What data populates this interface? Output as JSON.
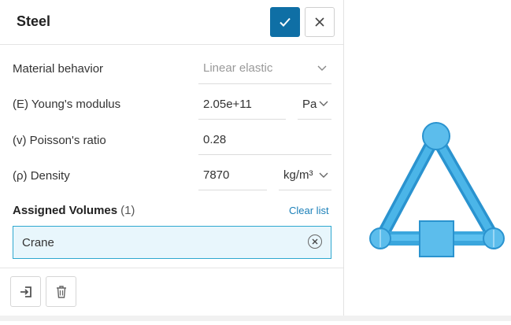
{
  "panel": {
    "title": "Steel",
    "confirm_icon": "check-icon",
    "close_icon": "close-icon"
  },
  "fields": {
    "material_behavior": {
      "label": "Material behavior",
      "value": "Linear elastic"
    },
    "youngs_modulus": {
      "label": "(E) Young's modulus",
      "value": "2.05e+11",
      "unit": "Pa"
    },
    "poissons_ratio": {
      "label": "(v) Poisson's ratio",
      "value": "0.28"
    },
    "density": {
      "label": "(ρ) Density",
      "value": "7870",
      "unit": "kg/m³"
    }
  },
  "assigned": {
    "title": "Assigned Volumes",
    "count": "(1)",
    "clear_label": "Clear list",
    "items": [
      {
        "label": "Crane"
      }
    ]
  },
  "footer": {
    "import_icon": "import-icon",
    "delete_icon": "trash-icon"
  },
  "colors": {
    "primary": "#0f6fa5",
    "link": "#1a7fb8",
    "chip_bg": "#e8f6fc",
    "chip_border": "#2ea8cf",
    "model": "#3aa9e0"
  }
}
